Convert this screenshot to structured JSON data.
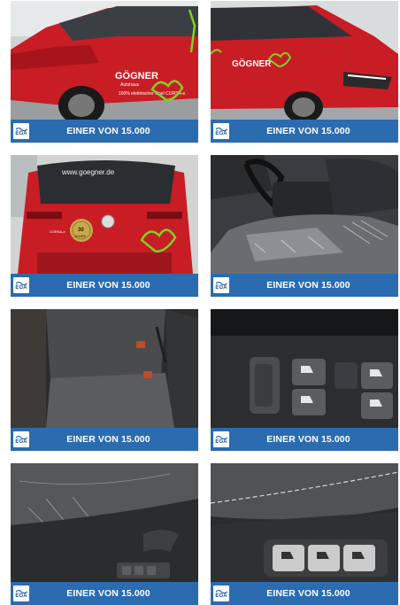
{
  "gallery": {
    "tiles": [
      {
        "alt": "Opel Corsa-e Front links",
        "logo": "EGA",
        "slogan": "EINER VON 15.000"
      },
      {
        "alt": "Opel Corsa-e Front rechts",
        "logo": "EGA",
        "slogan": "EINER VON 15.000"
      },
      {
        "alt": "Opel Corsa-e Heck",
        "logo": "EGA",
        "slogan": "EINER VON 15.000"
      },
      {
        "alt": "Fahrersitz",
        "logo": "EGA",
        "slogan": "EINER VON 15.000"
      },
      {
        "alt": "Rückbank",
        "logo": "EGA",
        "slogan": "EINER VON 15.000"
      },
      {
        "alt": "Fensterheber Schalter",
        "logo": "EGA",
        "slogan": "EINER VON 15.000"
      },
      {
        "alt": "Türverkleidung",
        "logo": "EGA",
        "slogan": "EINER VON 15.000"
      },
      {
        "alt": "Türgriff mit Schaltern",
        "logo": "EGA",
        "slogan": "EINER VON 15.000"
      }
    ],
    "car_decals": {
      "brand": "GÖGNER",
      "sub": "Autohaus",
      "line": "100% elektrischer Opel CORSA-e",
      "url": "www.goegner.de",
      "badge": "30",
      "badge_text": "JAHRE",
      "model": "CORSA-e"
    }
  },
  "colors": {
    "bar": "#2b6bb0",
    "car_red": "#c81d25",
    "decal_green": "#7ed321"
  }
}
